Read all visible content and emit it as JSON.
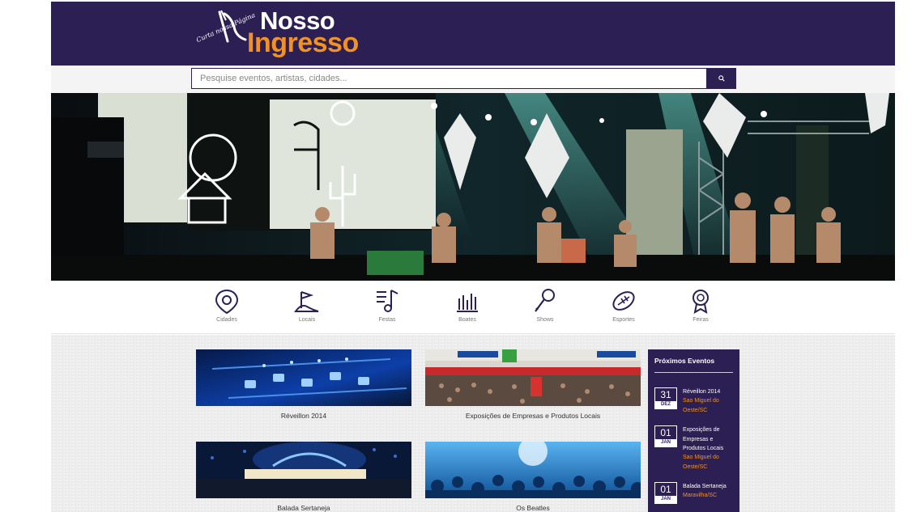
{
  "brand": {
    "tagline": "Curta nossa Página",
    "name_line1": "Nosso",
    "name_line2": "Ingresso",
    "primary_color": "#2c1f54",
    "accent_color": "#f39222"
  },
  "search": {
    "placeholder": "Pesquise eventos, artistas, cidades...",
    "button_icon": "search-icon"
  },
  "categories": [
    {
      "label": "Cidades",
      "icon": "map-pin-icon"
    },
    {
      "label": "Locais",
      "icon": "flag-icon"
    },
    {
      "label": "Festas",
      "icon": "music-note-icon"
    },
    {
      "label": "Boates",
      "icon": "equalizer-icon"
    },
    {
      "label": "Shows",
      "icon": "microphone-icon"
    },
    {
      "label": "Esportes",
      "icon": "ball-icon"
    },
    {
      "label": "Feiras",
      "icon": "badge-icon"
    }
  ],
  "events": [
    {
      "title": "Réveillon 2014"
    },
    {
      "title": "Exposições de Empresas e Produtos Locais"
    },
    {
      "title": "Balada Sertaneja"
    },
    {
      "title": "Os Beatles"
    }
  ],
  "sidebar": {
    "title": "Próximos Eventos",
    "items": [
      {
        "day": "31",
        "month": "DEZ",
        "name": "Réveillon 2014",
        "city": "Sao Miguel do Oeste/SC"
      },
      {
        "day": "01",
        "month": "JAN",
        "name": "Exposições de Empresas e Produtos Locais",
        "city": "Sao Miguel do Oeste/SC"
      },
      {
        "day": "01",
        "month": "JAN",
        "name": "Balada Sertaneja",
        "city": "Maravilha/SC"
      }
    ]
  }
}
